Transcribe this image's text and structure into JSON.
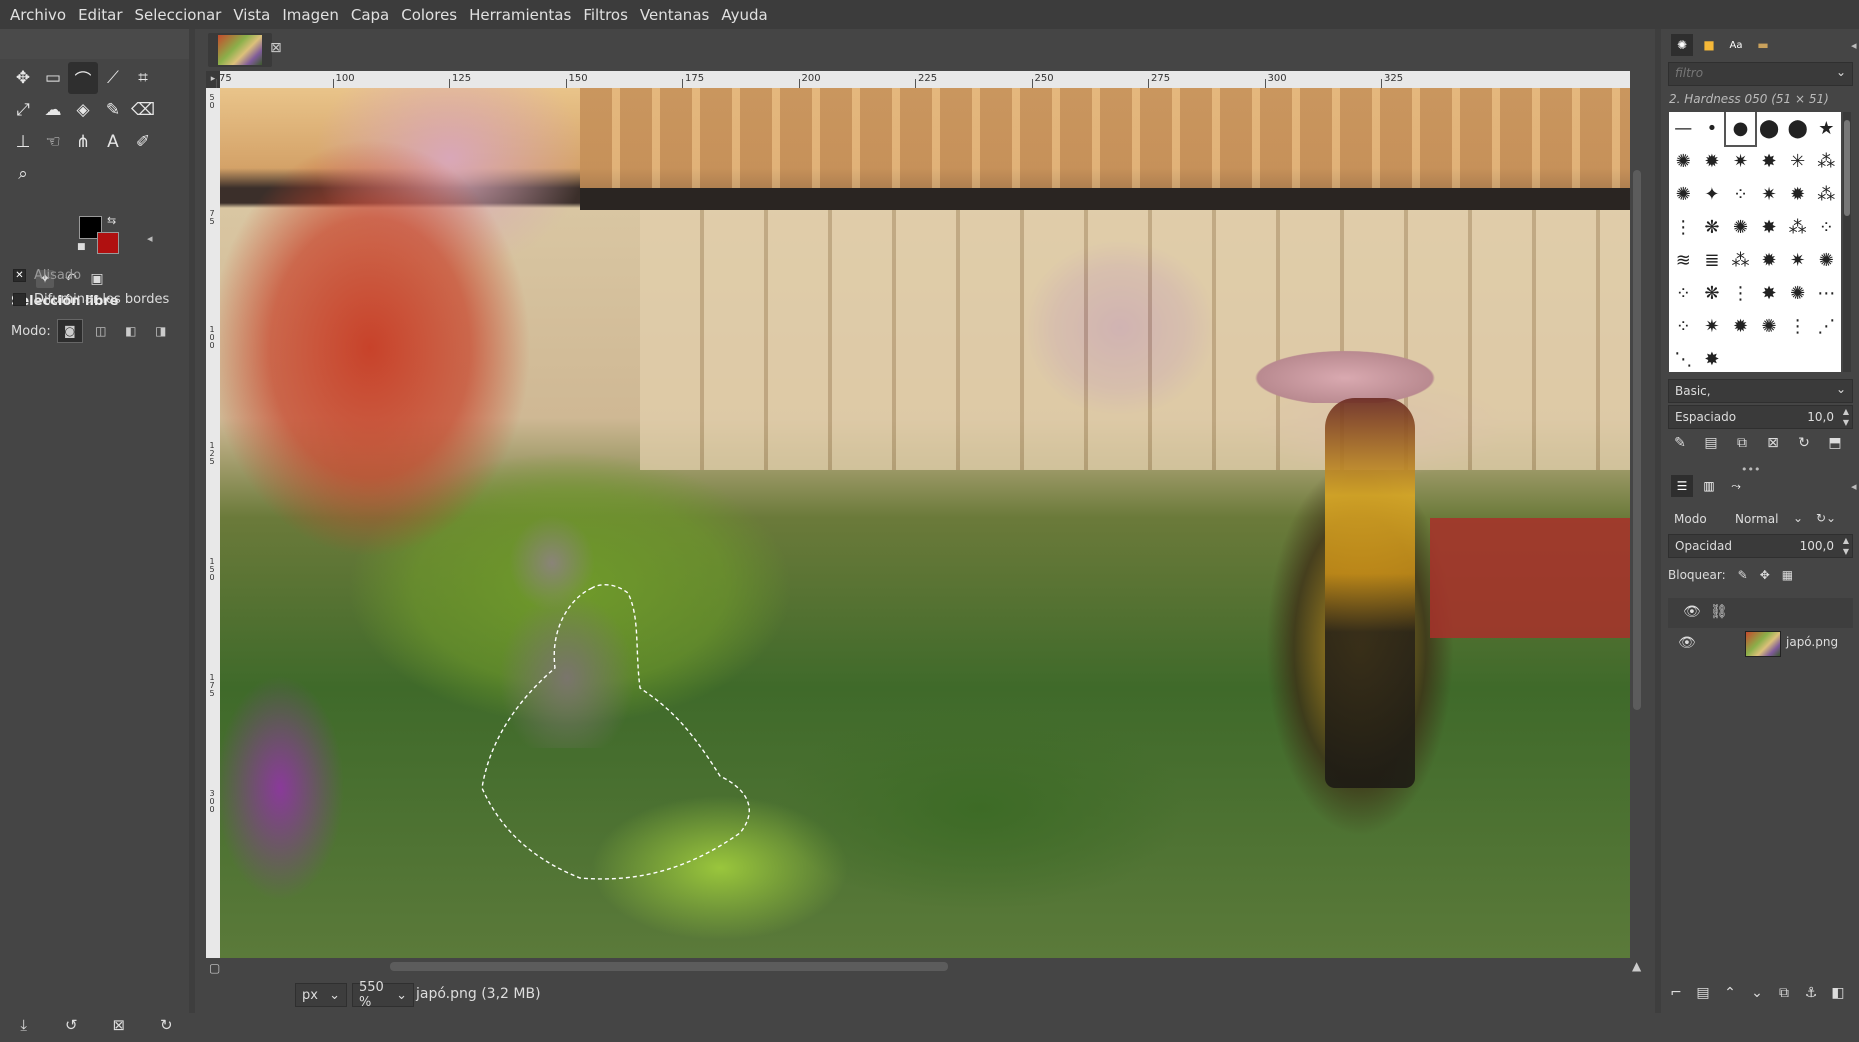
{
  "menubar": [
    "Archivo",
    "Editar",
    "Seleccionar",
    "Vista",
    "Imagen",
    "Capa",
    "Colores",
    "Herramientas",
    "Filtros",
    "Ventanas",
    "Ayuda"
  ],
  "toolbox": {
    "tools": [
      {
        "name": "move-tool-icon",
        "glyph": "✥"
      },
      {
        "name": "rect-select-tool-icon",
        "glyph": "▭"
      },
      {
        "name": "free-select-tool-icon",
        "glyph": "⌒",
        "active": true
      },
      {
        "name": "fuzzy-select-tool-icon",
        "glyph": "⟋"
      },
      {
        "name": "crop-tool-icon",
        "glyph": "⌗"
      },
      {
        "name": "blank-tool-slot",
        "glyph": ""
      },
      {
        "name": "transform-tool-icon",
        "glyph": "⤢"
      },
      {
        "name": "warp-tool-icon",
        "glyph": "☁"
      },
      {
        "name": "bucket-fill-tool-icon",
        "glyph": "◈"
      },
      {
        "name": "paintbrush-tool-icon",
        "glyph": "✎"
      },
      {
        "name": "eraser-tool-icon",
        "glyph": "⌫"
      },
      {
        "name": "blank-tool-slot-2",
        "glyph": ""
      },
      {
        "name": "clone-tool-icon",
        "glyph": "⊥"
      },
      {
        "name": "smudge-tool-icon",
        "glyph": "☜"
      },
      {
        "name": "paths-tool-icon",
        "glyph": "⋔"
      },
      {
        "name": "text-tool-icon",
        "glyph": "A"
      },
      {
        "name": "color-picker-tool-icon",
        "glyph": "✐"
      },
      {
        "name": "blank-tool-slot-3",
        "glyph": ""
      },
      {
        "name": "zoom-tool-icon",
        "glyph": "⌕"
      }
    ],
    "fg_color": "#000000",
    "bg_color": "#b01010",
    "options_title": "Selección libre",
    "mode_label": "Modo:",
    "antialias_label": "Alisado",
    "feather_label": "Difuminar los bordes"
  },
  "image_tab": {
    "close_glyph": "⊠"
  },
  "rulers": {
    "h_ticks": [
      "75",
      "100",
      "125",
      "150",
      "175",
      "200",
      "225",
      "250",
      "275",
      "300",
      "325"
    ],
    "v_ticks": [
      "50",
      "75",
      "100",
      "125",
      "150",
      "175",
      "300"
    ]
  },
  "status": {
    "unit": "px",
    "zoom": "550 %",
    "file": "japó.png (3,2 MB)"
  },
  "right_dock": {
    "filter_placeholder": "filtro",
    "brush_name": "2. Hardness 050 (51 × 51)",
    "brush_set": "Basic,",
    "spacing_label": "Espaciado",
    "spacing_value": "10,0",
    "mode_label": "Modo",
    "mode_value": "Normal",
    "opacity_label": "Opacidad",
    "opacity_value": "100,0",
    "lock_label": "Bloquear:",
    "layer_name": "japó.png"
  }
}
